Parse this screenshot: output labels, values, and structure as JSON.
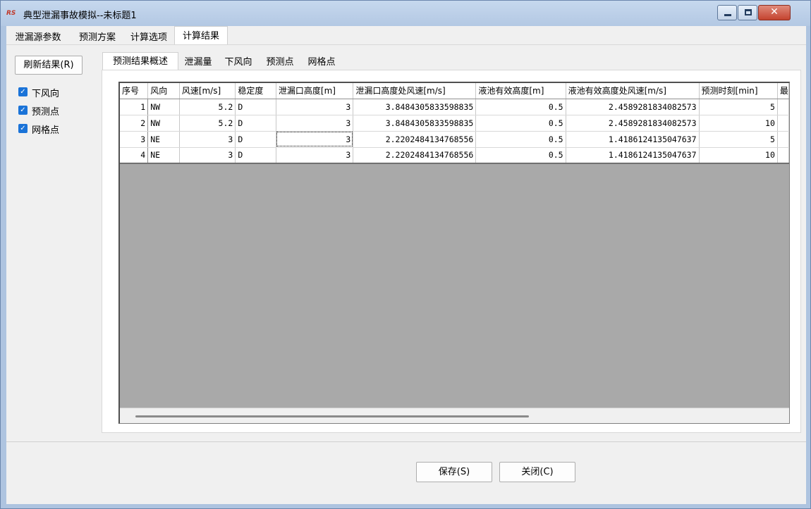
{
  "window": {
    "title": "典型泄漏事故模拟--未标题1",
    "icon_text": "⚗"
  },
  "main_tabs": [
    {
      "label": "泄漏源参数"
    },
    {
      "label": "预测方案"
    },
    {
      "label": "计算选项"
    },
    {
      "label": "计算结果"
    }
  ],
  "left_panel": {
    "refresh_label": "刷新结果(R)",
    "checkboxes": [
      {
        "label": "下风向",
        "checked": true
      },
      {
        "label": "预测点",
        "checked": true
      },
      {
        "label": "网格点",
        "checked": true
      }
    ]
  },
  "sub_tabs": [
    {
      "label": "预测结果概述"
    },
    {
      "label": "泄漏量"
    },
    {
      "label": "下风向"
    },
    {
      "label": "预测点"
    },
    {
      "label": "网格点"
    }
  ],
  "table": {
    "columns": [
      "序号",
      "风向",
      "风速[m/s]",
      "稳定度",
      "泄漏口高度[m]",
      "泄漏口高度处风速[m/s]",
      "液池有效高度[m]",
      "液池有效高度处风速[m/s]",
      "预测时刻[min]",
      "最"
    ],
    "rows": [
      [
        "1",
        "NW",
        "5.2",
        "D",
        "3",
        "3.8484305833598835",
        "0.5",
        "2.4589281834082573",
        "5",
        ""
      ],
      [
        "2",
        "NW",
        "5.2",
        "D",
        "3",
        "3.8484305833598835",
        "0.5",
        "2.4589281834082573",
        "10",
        ""
      ],
      [
        "3",
        "NE",
        "3",
        "D",
        "3",
        "2.2202484134768556",
        "0.5",
        "1.4186124135047637",
        "5",
        ""
      ],
      [
        "4",
        "NE",
        "3",
        "D",
        "3",
        "2.2202484134768556",
        "0.5",
        "1.4186124135047637",
        "10",
        ""
      ]
    ]
  },
  "buttons": {
    "save": "保存(S)",
    "close": "关闭(C)"
  }
}
